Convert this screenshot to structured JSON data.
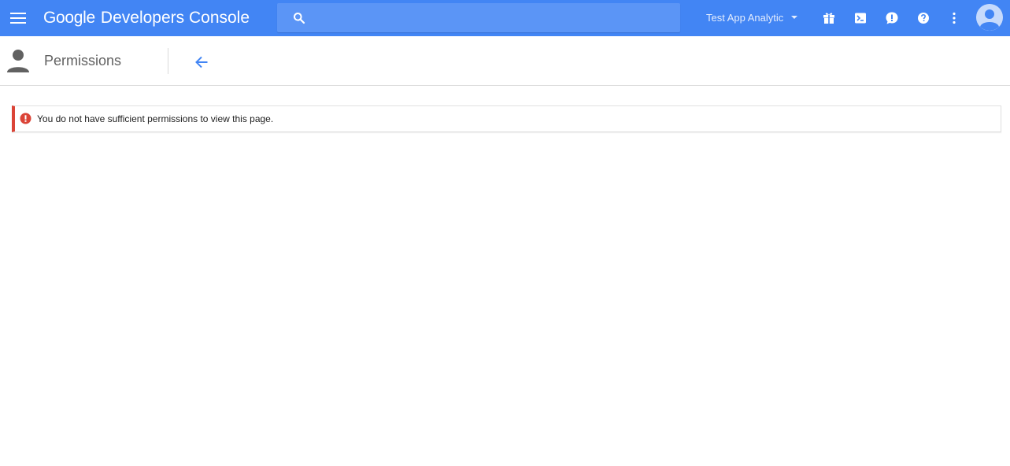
{
  "appbar": {
    "brand_google": "Google",
    "brand_product": "Developers Console",
    "search_placeholder": "",
    "project_name": "Test App Analytic",
    "colors": {
      "bar": "#4285f4",
      "search": "#5b95f6",
      "icon": "#ffffff"
    },
    "icons": [
      "menu-icon",
      "search-icon",
      "caret-down-icon",
      "gift-icon",
      "terminal-icon",
      "feedback-icon",
      "help-icon",
      "more-vert-icon",
      "account-icon"
    ]
  },
  "page_header": {
    "title": "Permissions",
    "icons": [
      "person-icon",
      "arrow-back-icon"
    ],
    "colors": {
      "back_arrow": "#4285f4",
      "title": "#616161"
    }
  },
  "error_banner": {
    "message": "You do not have sufficient permissions to view this page.",
    "colors": {
      "accent": "#db4437"
    }
  }
}
